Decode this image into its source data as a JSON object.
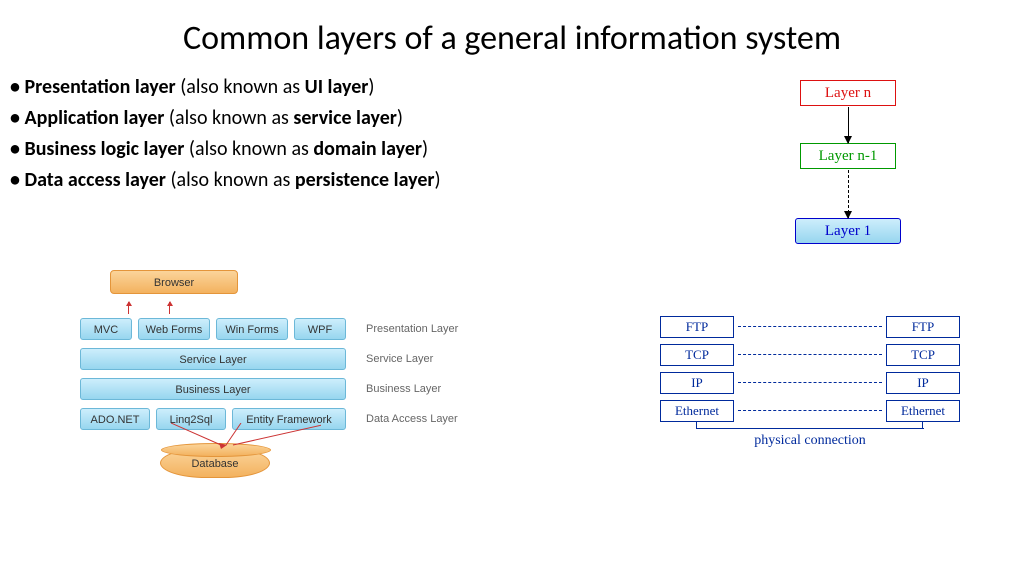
{
  "title": "Common layers of a general information system",
  "bullets": [
    {
      "b1": "Presentation layer",
      "mid": " (also known as ",
      "b2": "UI layer",
      "end": ")"
    },
    {
      "b1": "Application layer",
      "mid": " (also known as ",
      "b2": "service layer",
      "end": ")"
    },
    {
      "b1": "Business logic layer",
      "mid": " (also known as ",
      "b2": "domain layer",
      "end": ")"
    },
    {
      "b1": "Data access layer",
      "mid": " (also known as ",
      "b2": "persistence layer",
      "end": ")"
    }
  ],
  "right_diagram": {
    "top": "Layer n",
    "mid": "Layer n-1",
    "bot": "Layer 1"
  },
  "left_diagram": {
    "browser": "Browser",
    "presentation": {
      "items": [
        "MVC",
        "Web Forms",
        "Win Forms",
        "WPF"
      ],
      "label": "Presentation Layer"
    },
    "service": {
      "item": "Service Layer",
      "label": "Service Layer"
    },
    "business": {
      "item": "Business Layer",
      "label": "Business Layer"
    },
    "data": {
      "items": [
        "ADO.NET",
        "Linq2Sql",
        "Entity Framework"
      ],
      "label": "Data Access Layer"
    },
    "database": "Database"
  },
  "net_diagram": {
    "rows": [
      "FTP",
      "TCP",
      "IP",
      "Ethernet"
    ],
    "bottom": "physical connection"
  }
}
